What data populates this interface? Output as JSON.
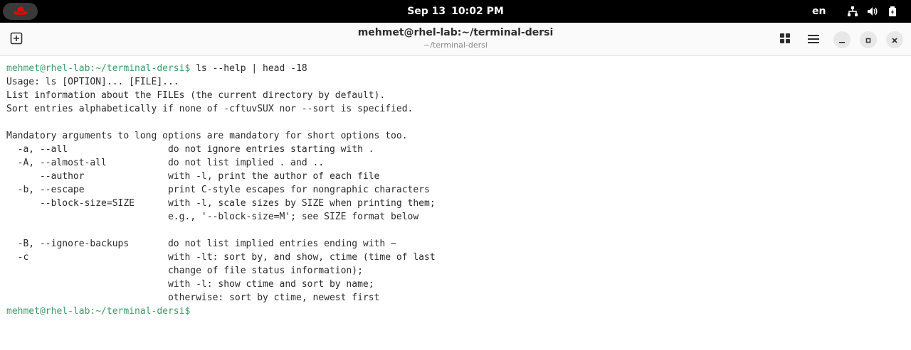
{
  "topbar": {
    "date": "Sep 13",
    "time": "10:02 PM",
    "lang": "en",
    "icons": [
      "redhat-logo-icon",
      "network-icon",
      "volume-icon",
      "power-battery-icon"
    ]
  },
  "window": {
    "title": "mehmet@rhel-lab:~/terminal-dersi",
    "subtitle": "~/terminal-dersi",
    "buttons": [
      "new-tab-icon",
      "tab-overview-icon",
      "menu-icon",
      "minimize-icon",
      "maximize-icon",
      "close-icon"
    ]
  },
  "terminal": {
    "prompt": "mehmet@rhel-lab:~/terminal-dersi$",
    "command": " ls --help | head -18",
    "output": [
      "Usage: ls [OPTION]... [FILE]...",
      "List information about the FILEs (the current directory by default).",
      "Sort entries alphabetically if none of -cftuvSUX nor --sort is specified.",
      "",
      "Mandatory arguments to long options are mandatory for short options too.",
      "  -a, --all                  do not ignore entries starting with .",
      "  -A, --almost-all           do not list implied . and ..",
      "      --author               with -l, print the author of each file",
      "  -b, --escape               print C-style escapes for nongraphic characters",
      "      --block-size=SIZE      with -l, scale sizes by SIZE when printing them;",
      "                             e.g., '--block-size=M'; see SIZE format below",
      "",
      "  -B, --ignore-backups       do not list implied entries ending with ~",
      "  -c                         with -lt: sort by, and show, ctime (time of last",
      "                             change of file status information);",
      "                             with -l: show ctime and sort by name;",
      "                             otherwise: sort by ctime, newest first",
      ""
    ],
    "final_prompt": "mehmet@rhel-lab:~/terminal-dersi$"
  },
  "colors": {
    "prompt": "#3d9b6a",
    "text": "#2b2b2b",
    "topbar": "#000000",
    "redhat": "#ee0000"
  }
}
